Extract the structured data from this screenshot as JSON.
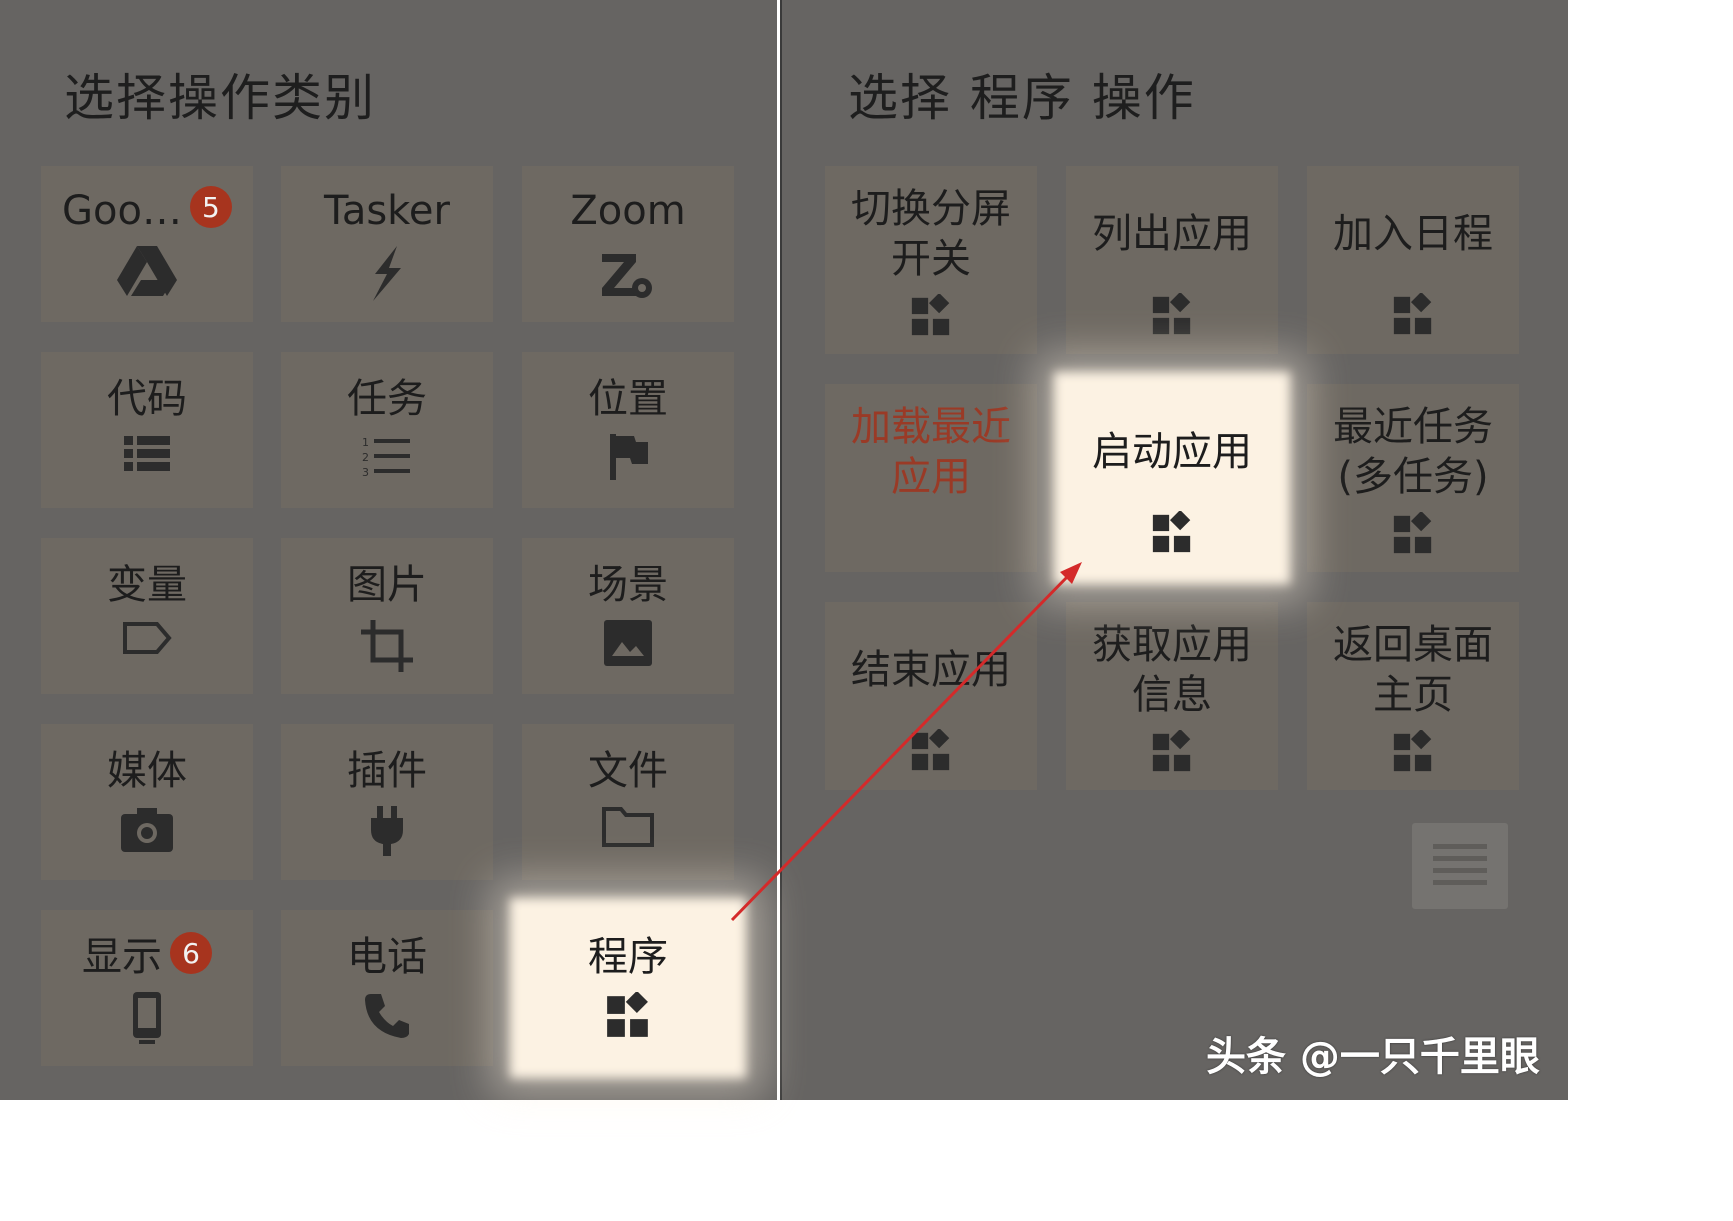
{
  "left_panel": {
    "title": "选择操作类别",
    "tiles": [
      {
        "label": "Goo…",
        "badge": "5",
        "icon": "google-drive-icon"
      },
      {
        "label": "Tasker",
        "icon": "lightning-icon"
      },
      {
        "label": "Zoom",
        "icon": "zoom-gear-icon"
      },
      {
        "label": "代码",
        "icon": "code-list-icon"
      },
      {
        "label": "任务",
        "icon": "numbered-list-icon"
      },
      {
        "label": "位置",
        "icon": "flag-icon"
      },
      {
        "label": "变量",
        "icon": "tag-icon"
      },
      {
        "label": "图片",
        "icon": "crop-icon"
      },
      {
        "label": "场景",
        "icon": "image-icon"
      },
      {
        "label": "媒体",
        "icon": "camera-icon"
      },
      {
        "label": "插件",
        "icon": "plug-icon"
      },
      {
        "label": "文件",
        "icon": "folder-icon"
      },
      {
        "label": "显示",
        "badge": "6",
        "icon": "phone-device-icon"
      },
      {
        "label": "电话",
        "icon": "phone-handset-icon"
      },
      {
        "label": "程序",
        "icon": "apps-icon",
        "highlighted": true
      }
    ]
  },
  "right_panel": {
    "title": "选择 程序 操作",
    "tiles": [
      {
        "label": "切换分屏\n开关",
        "icon": "apps-icon"
      },
      {
        "label": "列出应用",
        "icon": "apps-icon"
      },
      {
        "label": "加入日程",
        "icon": "apps-icon"
      },
      {
        "label": "加载最近\n应用",
        "color": "#9a3a26"
      },
      {
        "label": "启动应用",
        "icon": "apps-icon",
        "highlighted": true
      },
      {
        "label": "最近任务\n(多任务)",
        "icon": "apps-icon"
      },
      {
        "label": "结束应用",
        "icon": "apps-icon"
      },
      {
        "label": "获取应用\n信息",
        "icon": "apps-icon"
      },
      {
        "label": "返回桌面\n主页",
        "icon": "apps-icon"
      }
    ],
    "menu_icon": "menu-icon"
  },
  "watermark": "头条 @一只千里眼",
  "colors": {
    "panel_bg": "#666462",
    "tile_bg": "#6e6962",
    "highlight": "#fcf2e3",
    "badge": "#a7341e",
    "arrow": "#d42a2a"
  }
}
